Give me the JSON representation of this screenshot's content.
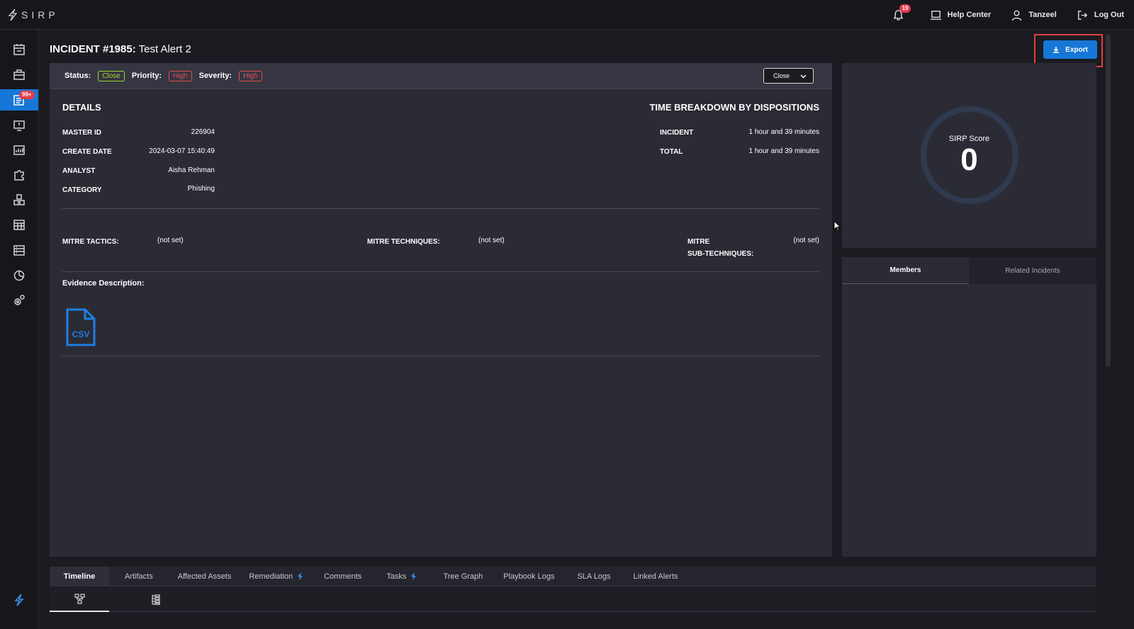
{
  "app": {
    "logo_text": "SIRP"
  },
  "topbar": {
    "notifications_count": "19",
    "help_label": "Help Center",
    "user_label": "Tanzeel",
    "logout_label": "Log Out"
  },
  "sidebar": {
    "incidents_badge": "99+"
  },
  "incident": {
    "title_prefix": "INCIDENT #1985:",
    "title_name": "Test Alert 2",
    "export_label": "Export",
    "status_label": "Status:",
    "status_value": "Close",
    "priority_label": "Priority:",
    "priority_value": "High",
    "severity_label": "Severity:",
    "severity_value": "High",
    "action_dropdown": "Close"
  },
  "details": {
    "heading": "DETAILS",
    "rows": [
      {
        "label": "MASTER ID",
        "value": "226904"
      },
      {
        "label": "CREATE DATE",
        "value": "2024-03-07 15:40:49"
      },
      {
        "label": "ANALYST",
        "value": "Aisha Rehman"
      },
      {
        "label": "CATEGORY",
        "value": "Phishing"
      }
    ]
  },
  "time_breakdown": {
    "heading": "TIME BREAKDOWN BY DISPOSITIONS",
    "rows": [
      {
        "label": "INCIDENT",
        "value": "1 hour and 39 minutes"
      },
      {
        "label": "TOTAL",
        "value": "1 hour and 39 minutes"
      }
    ]
  },
  "mitre": {
    "tactics_label": "MITRE TACTICS:",
    "tactics_value": "(not set)",
    "techniques_label": "MITRE TECHNIQUES:",
    "techniques_value": "(not set)",
    "subtech_label_1": "MITRE",
    "subtech_label_2": "SUB-TECHNIQUES:",
    "subtech_value": "(not set)"
  },
  "evidence": {
    "label": "Evidence Description:",
    "file_type": "CSV"
  },
  "score": {
    "label": "SIRP Score",
    "value": "0"
  },
  "side_tabs": [
    "Members",
    "Related Incidents"
  ],
  "bottom_tabs": [
    {
      "label": "Timeline"
    },
    {
      "label": "Artifacts"
    },
    {
      "label": "Affected Assets"
    },
    {
      "label": "Remediation"
    },
    {
      "label": "Comments"
    },
    {
      "label": "Tasks"
    },
    {
      "label": "Tree Graph"
    },
    {
      "label": "Playbook Logs"
    },
    {
      "label": "SLA Logs"
    },
    {
      "label": "Linked Alerts"
    }
  ],
  "colors": {
    "accent": "#1677d6",
    "status_close": "#9ad52c",
    "priority_high": "#e6494e",
    "highlight_border": "#e0403d"
  }
}
